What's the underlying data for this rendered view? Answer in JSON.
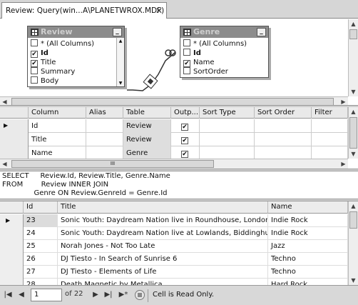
{
  "tab": {
    "title": "Review: Query(win...A\\PLANETWROX.MDF)",
    "close_glyph": "✕"
  },
  "diagram": {
    "review_table": {
      "title": "Review",
      "columns": [
        {
          "label": "* (All Columns)",
          "checked": false,
          "bold": false
        },
        {
          "label": "Id",
          "checked": true,
          "bold": true
        },
        {
          "label": "Title",
          "checked": true,
          "bold": false
        },
        {
          "label": "Summary",
          "checked": false,
          "bold": false
        },
        {
          "label": "Body",
          "checked": false,
          "bold": false
        }
      ]
    },
    "genre_table": {
      "title": "Genre",
      "columns": [
        {
          "label": "* (All Columns)",
          "checked": false,
          "bold": false
        },
        {
          "label": "Id",
          "checked": false,
          "bold": true
        },
        {
          "label": "Name",
          "checked": true,
          "bold": false
        },
        {
          "label": "SortOrder",
          "checked": false,
          "bold": false
        }
      ]
    }
  },
  "criteria": {
    "headers": [
      "Column",
      "Alias",
      "Table",
      "Outp...",
      "Sort Type",
      "Sort Order",
      "Filter"
    ],
    "rows": [
      {
        "column": "Id",
        "alias": "",
        "table": "Review",
        "output": true
      },
      {
        "column": "Title",
        "alias": "",
        "table": "Review",
        "output": true
      },
      {
        "column": "Name",
        "alias": "",
        "table": "Genre",
        "output": true
      }
    ],
    "scroll_label": "III"
  },
  "sql": {
    "lines": [
      "SELECT     Review.Id, Review.Title, Genre.Name",
      "FROM        Review INNER JOIN",
      "              Genre ON Review.GenreId = Genre.Id"
    ]
  },
  "results": {
    "headers": [
      "Id",
      "Title",
      "Name"
    ],
    "rows": [
      {
        "id": "23",
        "title": "Sonic Youth: Daydream Nation live in Roundhouse, London",
        "name": "Indie Rock"
      },
      {
        "id": "24",
        "title": "Sonic Youth: Daydream Nation live at Lowlands, Biddinghuizen",
        "name": "Indie Rock"
      },
      {
        "id": "25",
        "title": "Norah Jones - Not Too Late",
        "name": "Jazz"
      },
      {
        "id": "26",
        "title": "DJ Tiesto - In Search of Sunrise 6",
        "name": "Techno"
      },
      {
        "id": "27",
        "title": "DJ Tiesto - Elements of Life",
        "name": "Techno"
      },
      {
        "id": "28",
        "title": "Death Magnetic by Metallica",
        "name": "Hard Rock"
      }
    ]
  },
  "statusbar": {
    "current_page": "1",
    "page_total": "of 22",
    "status_text": "Cell is Read Only."
  }
}
